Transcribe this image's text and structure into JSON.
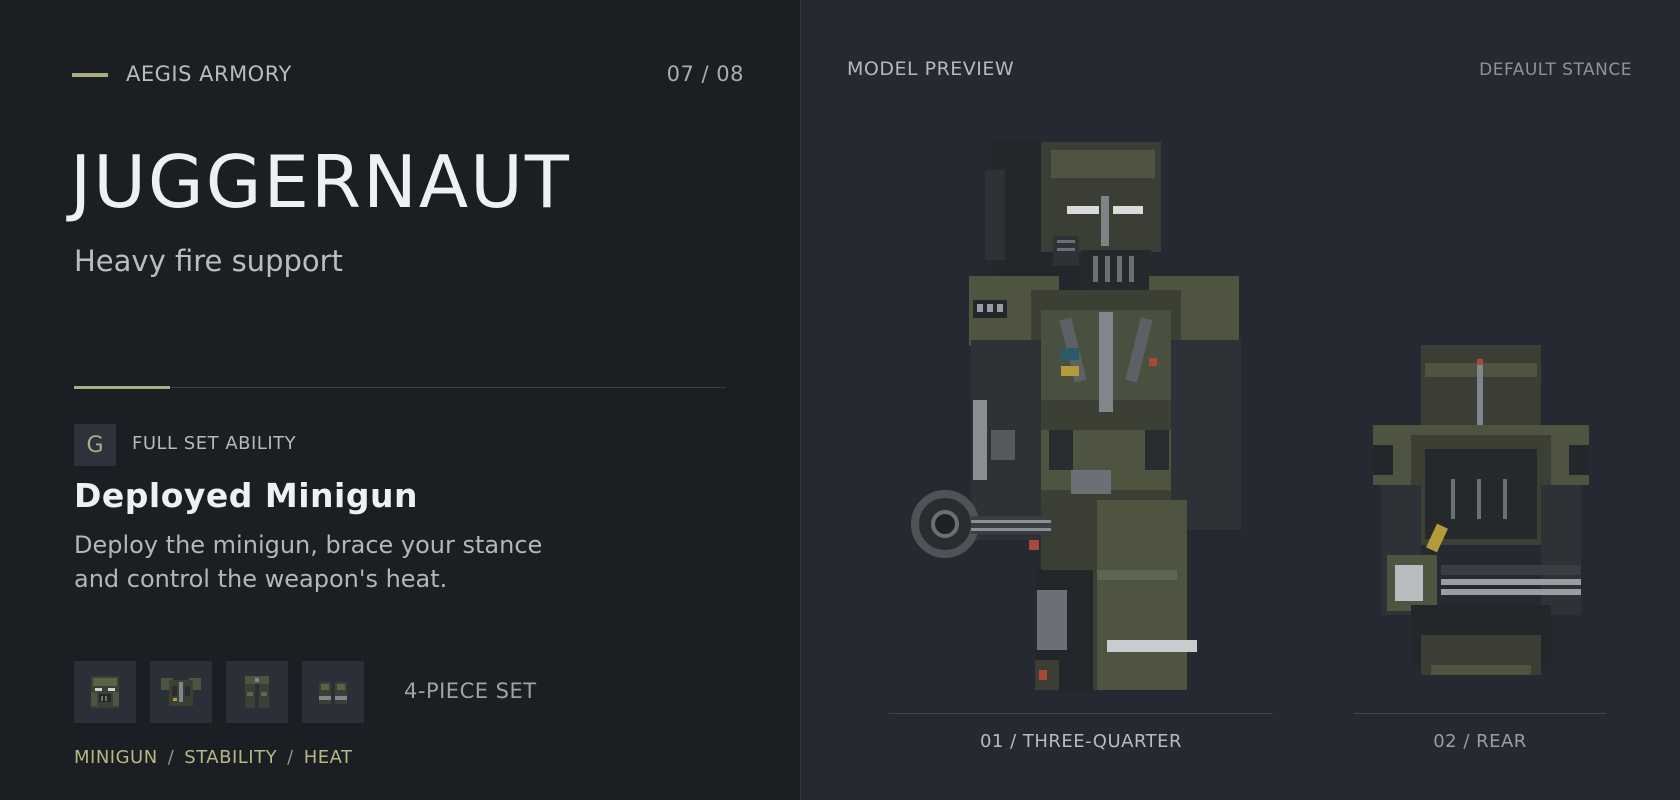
{
  "brand": "AEGIS ARMORY",
  "counter": "07 / 08",
  "hero": {
    "title": "JUGGERNAUT",
    "subtitle": "Heavy fire support"
  },
  "ability": {
    "key": "G",
    "label": "FULL SET ABILITY",
    "name": "Deployed Minigun",
    "description": "Deploy the minigun, brace your stance and control the weapon's heat."
  },
  "set": {
    "pieces": [
      "helmet-icon",
      "chest-armor-icon",
      "leg-armor-icon",
      "boots-icon"
    ],
    "label": "4-PIECE SET"
  },
  "tags": [
    "MINIGUN",
    "STABILITY",
    "HEAT"
  ],
  "preview": {
    "label": "MODEL PREVIEW",
    "stance": "DEFAULT STANCE",
    "views": [
      "01 / THREE-QUARTER",
      "02 / REAR"
    ]
  },
  "colors": {
    "accent": "#a9ad80",
    "left_bg": "#1b1e23",
    "right_bg": "#252932",
    "armor_olive": "#4e5440",
    "armor_dark": "#2a2d30"
  }
}
